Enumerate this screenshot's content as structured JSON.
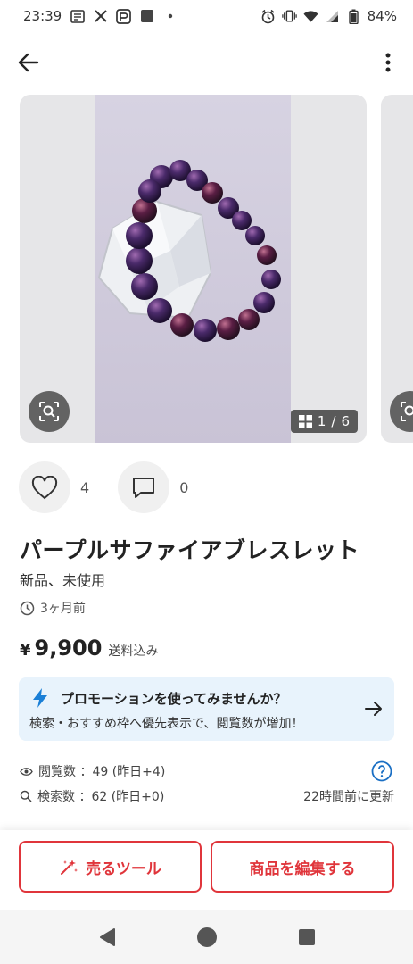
{
  "status_bar": {
    "time": "23:39",
    "battery": "84%"
  },
  "carousel": {
    "page_current": "1",
    "page_separator": "/",
    "page_total": "6"
  },
  "reactions": {
    "likes": "4",
    "comments": "0"
  },
  "item": {
    "title": "パープルサファイアブレスレット",
    "condition": "新品、未使用",
    "posted": "3ヶ月前",
    "price_symbol": "¥",
    "price": "9,900",
    "shipping": "送料込み"
  },
  "promo": {
    "title": "プロモーションを使ってみませんか？",
    "description": "検索・おすすめ枠へ優先表示で、閲覧数が増加！"
  },
  "stats": {
    "views": "閲覧数 ：49 (昨日+4)",
    "searches": "検索数 ：62 (昨日+0)",
    "updated": "22時間前に更新"
  },
  "actions": {
    "sell_tool": "売るツール",
    "edit_item": "商品を編集する"
  },
  "colors": {
    "accent": "#e0353b",
    "promo_bg": "#e8f3fc",
    "promo_icon": "#1a7fd6"
  }
}
